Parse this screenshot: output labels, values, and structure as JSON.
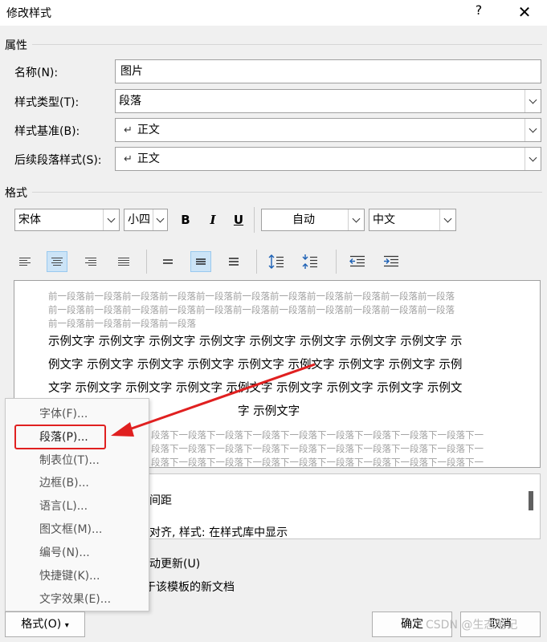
{
  "window": {
    "title": "修改样式",
    "help": "?",
    "close": "✕"
  },
  "properties": {
    "section": "属性",
    "name_label": "名称(N):",
    "name_value": "图片",
    "type_label": "样式类型(T):",
    "type_value": "段落",
    "base_label": "样式基准(B):",
    "base_mark": "↵",
    "base_value": "正文",
    "next_label": "后续段落样式(S):",
    "next_mark": "↵",
    "next_value": "正文"
  },
  "format": {
    "section": "格式",
    "font": "宋体",
    "size": "小四",
    "bold": "B",
    "italic": "I",
    "underline": "U",
    "color": "自动",
    "script": "中文"
  },
  "preview": {
    "prev_para": [
      "前一段落前一段落前一段落前一段落前一段落前一段落前一段落前一段落前一段落前一段落前一段落",
      "前一段落前一段落前一段落前一段落前一段落前一段落前一段落前一段落前一段落前一段落前一段落",
      "前一段落前一段落前一段落前一段落"
    ],
    "sample_lines": [
      "示例文字 示例文字 示例文字 示例文字 示例文字 示例文字 示例文字 示例文字 示",
      "例文字 示例文字 示例文字 示例文字 示例文字 示例文字 示例文字 示例文字 示例",
      "文字 示例文字 示例文字 示例文字 示例文字 示例文字 示例文字 示例文字 示例文",
      "字 示例文字"
    ],
    "next_para": [
      "段落下一段落下一段落下一段落下一段落下一段落下一段落下一段落下一段落下一",
      "段落下一段落下一段落下一段落下一段落下一段落下一段落下一段落下一段落下一",
      "段落下一段落下一段落下一段落下一段落下一段落下一段落下一段落下一段落下一"
    ]
  },
  "description": {
    "line1": "间距",
    "line2": "对齐, 样式: 在样式库中显示"
  },
  "options": {
    "auto_update": "动更新(U)",
    "template": "于该模板的新文档"
  },
  "menu": {
    "items": [
      "字体(F)...",
      "段落(P)...",
      "制表位(T)...",
      "边框(B)...",
      "语言(L)...",
      "图文框(M)...",
      "编号(N)...",
      "快捷键(K)...",
      "文字效果(E)..."
    ]
  },
  "buttons": {
    "format": "格式(O)",
    "format_arrow": "▾",
    "ok": "确定",
    "cancel": "取消"
  },
  "watermark": "CSDN @生态笔记",
  "colors": {
    "accent_active": "#cce4f7",
    "highlight_red": "#e02020"
  }
}
